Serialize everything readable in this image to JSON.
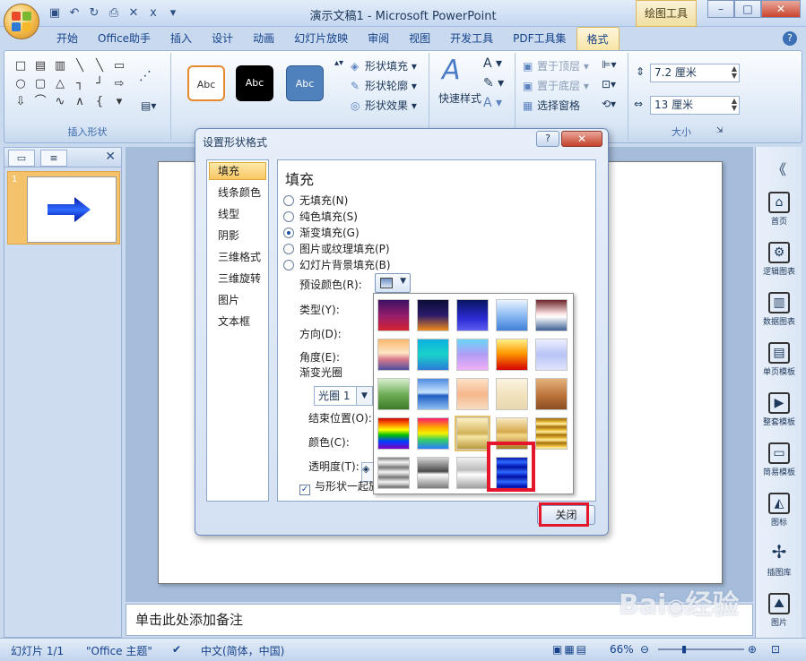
{
  "window": {
    "title": "演示文稿1 - Microsoft PowerPoint",
    "context_tool": "绘图工具"
  },
  "tabs": [
    "开始",
    "Office助手",
    "插入",
    "设计",
    "动画",
    "幻灯片放映",
    "审阅",
    "视图",
    "开发工具",
    "PDF工具集",
    "格式"
  ],
  "active_tab": "格式",
  "ribbon": {
    "insert_shapes_label": "插入形状",
    "style_samples": [
      "Abc",
      "Abc",
      "Abc"
    ],
    "shape_fill": "形状填充",
    "shape_outline": "形状轮廓",
    "shape_effects": "形状效果",
    "quick_styles": "快速样式",
    "bring_to_front": "置于顶层",
    "send_to_back": "置于底层",
    "selection_pane": "选择窗格",
    "height_value": "7.2 厘米",
    "width_value": "13 厘米",
    "size_label": "大小"
  },
  "thumbnail_pane": {
    "slide_number": "1"
  },
  "notes_placeholder": "单击此处添加备注",
  "side_pane": {
    "collapse": "《",
    "items": [
      "首页",
      "逻辑图表",
      "数据图表",
      "单页模板",
      "整套模板",
      "简易模板",
      "图标",
      "插图库",
      "图片"
    ]
  },
  "status": {
    "slide": "幻灯片 1/1",
    "theme": "\"Office 主题\"",
    "language": "中文(简体，中国)",
    "zoom": "66%"
  },
  "dialog": {
    "title": "设置形状格式",
    "help": "?",
    "nav": [
      "填充",
      "线条颜色",
      "线型",
      "阴影",
      "三维格式",
      "三维旋转",
      "图片",
      "文本框"
    ],
    "nav_active": "填充",
    "heading": "填充",
    "fill_options": [
      "无填充(N)",
      "纯色填充(S)",
      "渐变填充(G)",
      "图片或纹理填充(P)",
      "幻灯片背景填充(B)"
    ],
    "selected_fill": "渐变填充(G)",
    "preset_colors_label": "预设颜色(R):",
    "type_label": "类型(Y):",
    "direction_label": "方向(D):",
    "angle_label": "角度(E):",
    "gradient_stops_label": "渐变光圈",
    "stop_value": "光圈 1",
    "end_position_label": "结束位置(O):",
    "color_label": "颜色(C):",
    "transparency_label": "透明度(T):",
    "rotate_with_shape": "与形状一起旋",
    "close_button": "关闭"
  },
  "gradient_presets": {
    "selected_index": 18,
    "cells": [
      "linear-gradient(#3b1063,#9b1f6b 55%,#d6222f)",
      "linear-gradient(#0c0c38,#2b1b6a 50%,#f08a1c)",
      "linear-gradient(#081560,#2b2bd4 60%,#5c5cf0)",
      "linear-gradient(#e9f3ff,#8dbbf2 50%,#3f7fd8)",
      "linear-gradient(#6b2428,#fde2e4 45%,#ffffff 55%,#3b5e93)",
      "linear-gradient(#fbb86e,#fde5c6 45%,#d87a8a 65%,#4b4fa0)",
      "linear-gradient(#0bb0e0,#19d2c9 50%,#2a7bd9)",
      "linear-gradient(#6ad6f8,#b39cf4 50%,#f0b0f6)",
      "linear-gradient(#fff08a,#ff9a00 45%,#d40000)",
      "linear-gradient(#ecefff,#b9c4f6 50%,#dfe3fb)",
      "linear-gradient(#d6efcd,#6aa851 55%,#3f7a2a)",
      "linear-gradient(#4f8be0,#c7e4ff 45%,#1f5ec3 55%,#8ec0f4)",
      "linear-gradient(#fde3c7,#f6b78d 50%,#f7dcc0)",
      "linear-gradient(#fbf3e1,#f2e3bf 50%,#e8d7ae)",
      "linear-gradient(#e6b27a,#b9733a 55%,#8c4e22)",
      "linear-gradient(#d00000,#ff7f00 20%,#ffff00 38%,#00c000 55%,#0040ff 75%,#8000c0)",
      "linear-gradient(#ff1a6c,#ffa900 30%,#f2f200 50%,#37d060 70%,#2a7bff)",
      "linear-gradient(#fdf1c3,#d2b257 50%,#f6e6a4 60%,#bb9a3e)",
      "linear-gradient(#f9eac1,#d6a84b 45%,#f3d889 55%,#a97a22)",
      "repeating-linear-gradient(#9a6a0f 0px,#e8b836 4px,#fff1a4 6px,#c0891a 9px)",
      "repeating-linear-gradient(#7c7c7c 0px,#f4f4f4 5px,#bdbdbd 8px,#6f6f6f 11px)",
      "linear-gradient(#d6d6d6,#4a4a4a 45%,#ffffff 55%,#7a7a7a)",
      "linear-gradient(#f2f2f2,#bcbcbc 40%,#ffffff 55%,#9f9f9f)",
      "repeating-linear-gradient(#0a1aa8 0px,#2e6bff 5px,#0b22c2 9px,#0011a0 11px)"
    ]
  }
}
